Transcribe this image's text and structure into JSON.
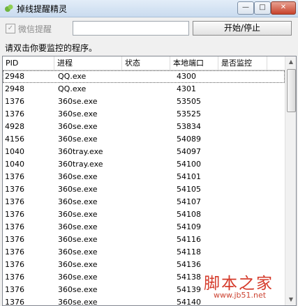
{
  "window": {
    "title": "掉线提醒精灵",
    "controls": {
      "minimize": "—",
      "maximize": "□",
      "close": "✕"
    }
  },
  "toolbar": {
    "wechat_checkbox_label": "微信提醒",
    "wechat_checked": true,
    "wechat_input_value": "",
    "start_stop_label": "开始/停止"
  },
  "hint": "请双击你要监控的程序。",
  "table": {
    "columns": [
      "PID",
      "进程",
      "状态",
      "本地端口",
      "是否监控"
    ],
    "rows": [
      {
        "pid": "2948",
        "process": "QQ.exe",
        "state": "",
        "port": "4300",
        "monitor": ""
      },
      {
        "pid": "2948",
        "process": "QQ.exe",
        "state": "",
        "port": "4301",
        "monitor": ""
      },
      {
        "pid": "1376",
        "process": "360se.exe",
        "state": "",
        "port": "53505",
        "monitor": ""
      },
      {
        "pid": "1376",
        "process": "360se.exe",
        "state": "",
        "port": "53525",
        "monitor": ""
      },
      {
        "pid": "4928",
        "process": "360se.exe",
        "state": "",
        "port": "53834",
        "monitor": ""
      },
      {
        "pid": "4156",
        "process": "360se.exe",
        "state": "",
        "port": "54089",
        "monitor": ""
      },
      {
        "pid": "1040",
        "process": "360tray.exe",
        "state": "",
        "port": "54097",
        "monitor": ""
      },
      {
        "pid": "1040",
        "process": "360tray.exe",
        "state": "",
        "port": "54100",
        "monitor": ""
      },
      {
        "pid": "1376",
        "process": "360se.exe",
        "state": "",
        "port": "54101",
        "monitor": ""
      },
      {
        "pid": "1376",
        "process": "360se.exe",
        "state": "",
        "port": "54105",
        "monitor": ""
      },
      {
        "pid": "1376",
        "process": "360se.exe",
        "state": "",
        "port": "54107",
        "monitor": ""
      },
      {
        "pid": "1376",
        "process": "360se.exe",
        "state": "",
        "port": "54108",
        "monitor": ""
      },
      {
        "pid": "1376",
        "process": "360se.exe",
        "state": "",
        "port": "54109",
        "monitor": ""
      },
      {
        "pid": "1376",
        "process": "360se.exe",
        "state": "",
        "port": "54116",
        "monitor": ""
      },
      {
        "pid": "1376",
        "process": "360se.exe",
        "state": "",
        "port": "54118",
        "monitor": ""
      },
      {
        "pid": "1376",
        "process": "360se.exe",
        "state": "",
        "port": "54136",
        "monitor": ""
      },
      {
        "pid": "1376",
        "process": "360se.exe",
        "state": "",
        "port": "54138",
        "monitor": ""
      },
      {
        "pid": "1376",
        "process": "360se.exe",
        "state": "",
        "port": "54139",
        "monitor": ""
      },
      {
        "pid": "1376",
        "process": "360se.exe",
        "state": "",
        "port": "54140",
        "monitor": ""
      }
    ],
    "selected_row": 0
  },
  "watermark": {
    "main": "脚本之家",
    "sub": "www.jb51.net"
  },
  "icons": {
    "app": "leaf-app-icon",
    "scroll_up": "scroll-up-arrow-icon",
    "scroll_down": "scroll-down-arrow-icon"
  }
}
